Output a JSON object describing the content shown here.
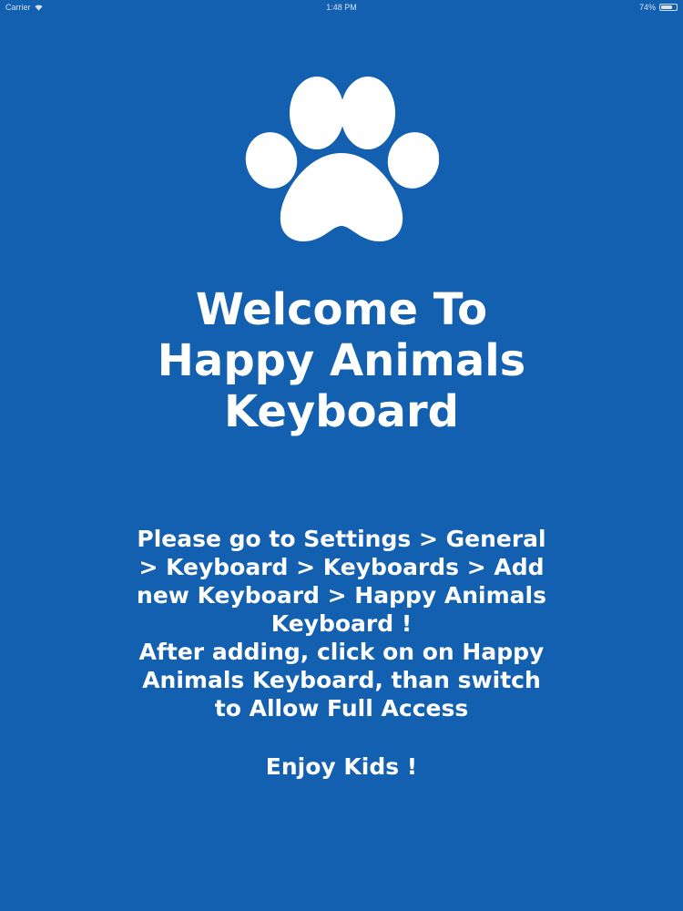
{
  "status_bar": {
    "carrier": "Carrier",
    "time": "1:48 PM",
    "battery_percent": "74%",
    "battery_level": 0.74
  },
  "logo": {
    "icon": "paw-icon",
    "color": "#ffffff"
  },
  "title": {
    "lines": [
      "Welcome To",
      "Happy Animals",
      "Keyboard"
    ]
  },
  "instructions": {
    "lines": [
      "Please go to Settings > General",
      "> Keyboard > Keyboards > Add",
      "new Keyboard > Happy Animals",
      "Keyboard !",
      "After adding, click on on Happy",
      "Animals Keyboard, than switch",
      "to Allow Full Access"
    ]
  },
  "closing": "Enjoy Kids !",
  "colors": {
    "background": "#135fb0",
    "text": "#ffffff"
  }
}
